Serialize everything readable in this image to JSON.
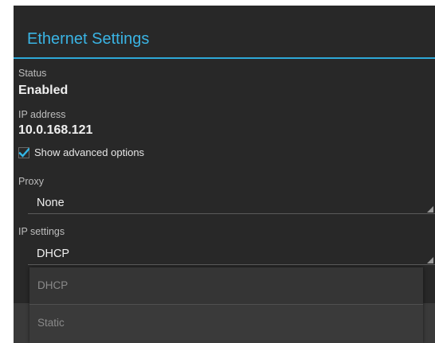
{
  "dialog": {
    "title": "Ethernet Settings",
    "accent_color": "#33b5e5"
  },
  "status": {
    "label": "Status",
    "value": "Enabled"
  },
  "ip_address": {
    "label": "IP address",
    "value": "10.0.168.121"
  },
  "advanced": {
    "label": "Show advanced options",
    "checked": true
  },
  "proxy": {
    "label": "Proxy",
    "selected": "None"
  },
  "ip_settings": {
    "label": "IP settings",
    "selected": "DHCP",
    "options": [
      "DHCP",
      "Static"
    ]
  },
  "icons": {
    "checkbox": "checkmark-icon",
    "spinner": "spinner-corner-triangle-icon"
  }
}
